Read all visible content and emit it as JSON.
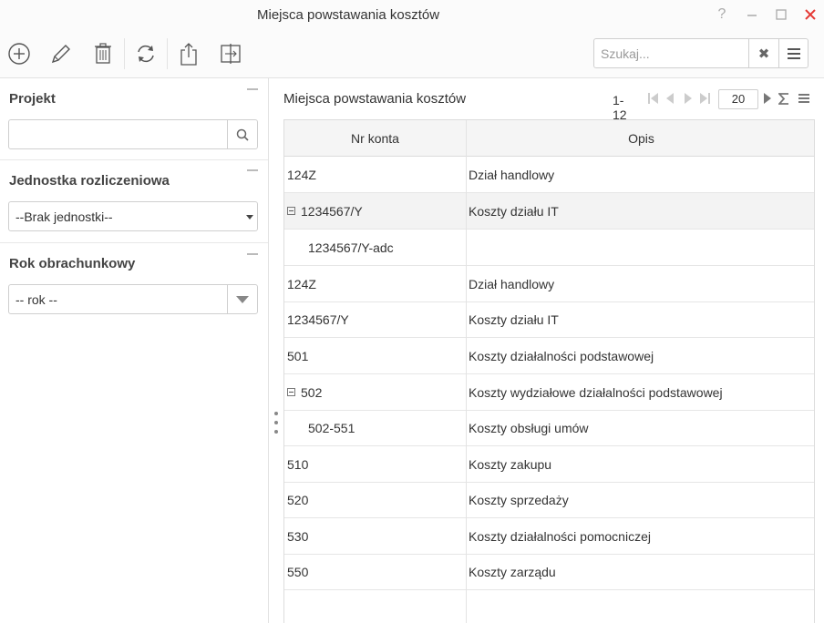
{
  "window": {
    "title": "Miejsca powstawania kosztów",
    "help_label": "?",
    "minimize_label": "—",
    "maximize_label": "☐",
    "close_label": "✕"
  },
  "toolbar": {
    "buttons": [
      {
        "icon": "add-icon"
      },
      {
        "icon": "edit-icon"
      },
      {
        "icon": "delete-icon"
      },
      {
        "icon": "refresh-icon"
      },
      {
        "icon": "export-icon"
      },
      {
        "icon": "split-view-icon"
      }
    ],
    "search_placeholder": "Szukaj...",
    "search_value": "",
    "clear_label": "✖"
  },
  "filters": {
    "project": {
      "label": "Projekt",
      "value": ""
    },
    "unit": {
      "label": "Jednostka rozliczeniowa",
      "value": "--Brak jednostki--"
    },
    "year": {
      "label": "Rok obrachunkowy",
      "value": "-- rok --"
    }
  },
  "grid": {
    "title": "Miejsca powstawania kosztów",
    "range": "1-12",
    "page_size": "20",
    "columns": [
      "Nr konta",
      "Opis"
    ],
    "rows": [
      {
        "nr": "124Z",
        "opis": "Dział handlowy",
        "level": 0,
        "expanded": false
      },
      {
        "nr": "1234567/Y",
        "opis": "Koszty działu IT",
        "level": 0,
        "expanded": true
      },
      {
        "nr": "1234567/Y-adc",
        "opis": "",
        "level": 1,
        "expanded": false
      },
      {
        "nr": "124Z",
        "opis": "Dział handlowy",
        "level": 0,
        "expanded": false
      },
      {
        "nr": "1234567/Y",
        "opis": "Koszty działu IT",
        "level": 0,
        "expanded": false
      },
      {
        "nr": "501",
        "opis": "Koszty działalności podstawowej",
        "level": 0,
        "expanded": false
      },
      {
        "nr": "502",
        "opis": "Koszty wydziałowe działalności podstawowej",
        "level": 0,
        "expanded": true
      },
      {
        "nr": "502-551",
        "opis": "Koszty obsługi umów",
        "level": 1,
        "expanded": false
      },
      {
        "nr": "510",
        "opis": "Koszty zakupu",
        "level": 0,
        "expanded": false
      },
      {
        "nr": "520",
        "opis": "Koszty sprzedaży",
        "level": 0,
        "expanded": false
      },
      {
        "nr": "530",
        "opis": "Koszty działalności pomocniczej",
        "level": 0,
        "expanded": false
      },
      {
        "nr": "550",
        "opis": "Koszty zarządu",
        "level": 0,
        "expanded": false
      }
    ]
  },
  "colors": {
    "close": "#e53935",
    "selected_row": "#f3f3f3",
    "header_bg": "#f5f5f5",
    "border": "#cfcfcf"
  }
}
